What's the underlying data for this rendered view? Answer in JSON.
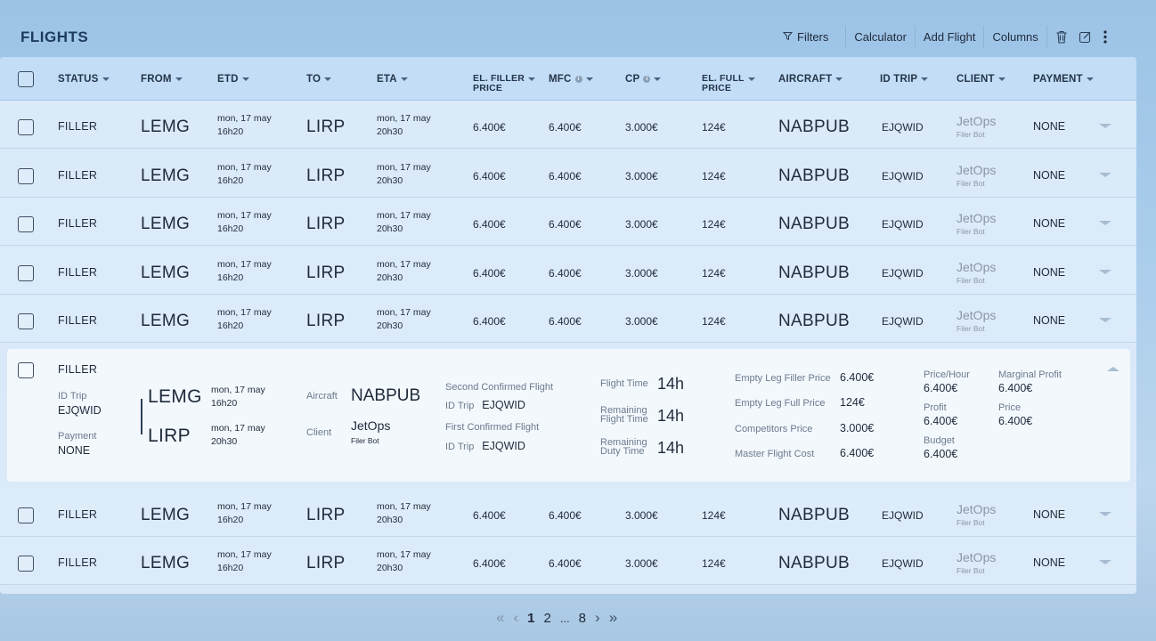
{
  "title": "FLIGHTS",
  "toolbar": {
    "filters": "Filters",
    "calculator": "Calculator",
    "add_flight": "Add Flight",
    "columns": "Columns",
    "icons": [
      "filter-icon",
      "trash-icon",
      "edit-icon",
      "more-icon"
    ]
  },
  "columns": [
    "STATUS",
    "FROM",
    "ETD",
    "TO",
    "ETA",
    "EL. FILLER PRICE",
    "MFC",
    "CP",
    "EL. FULL PRICE",
    "AIRCRAFT",
    "ID TRIP",
    "CLIENT",
    "PAYMENT"
  ],
  "column_lines": {
    "el_filler_1": "EL. FILLER",
    "el_filler_2": "PRICE",
    "el_full_1": "EL. FULL",
    "el_full_2": "PRICE"
  },
  "rows": [
    {
      "status": "FILLER",
      "from": "LEMG",
      "etd_day": "mon, 17 may",
      "etd_time": "16h20",
      "to": "LIRP",
      "eta_day": "mon, 17 may",
      "eta_time": "20h30",
      "el_filler_price": "6.400€",
      "mfc": "6.400€",
      "cp": "3.000€",
      "el_full_price": "124€",
      "aircraft": "NABPUB",
      "id_trip": "EJQWID",
      "client": "JetOps",
      "client_sub": "Filer Bot",
      "payment": "NONE"
    },
    {
      "status": "FILLER",
      "from": "LEMG",
      "etd_day": "mon, 17 may",
      "etd_time": "16h20",
      "to": "LIRP",
      "eta_day": "mon, 17 may",
      "eta_time": "20h30",
      "el_filler_price": "6.400€",
      "mfc": "6.400€",
      "cp": "3.000€",
      "el_full_price": "124€",
      "aircraft": "NABPUB",
      "id_trip": "EJQWID",
      "client": "JetOps",
      "client_sub": "Filer Bot",
      "payment": "NONE"
    },
    {
      "status": "FILLER",
      "from": "LEMG",
      "etd_day": "mon, 17 may",
      "etd_time": "16h20",
      "to": "LIRP",
      "eta_day": "mon, 17 may",
      "eta_time": "20h30",
      "el_filler_price": "6.400€",
      "mfc": "6.400€",
      "cp": "3.000€",
      "el_full_price": "124€",
      "aircraft": "NABPUB",
      "id_trip": "EJQWID",
      "client": "JetOps",
      "client_sub": "Filer Bot",
      "payment": "NONE"
    },
    {
      "status": "FILLER",
      "from": "LEMG",
      "etd_day": "mon, 17 may",
      "etd_time": "16h20",
      "to": "LIRP",
      "eta_day": "mon, 17 may",
      "eta_time": "20h30",
      "el_filler_price": "6.400€",
      "mfc": "6.400€",
      "cp": "3.000€",
      "el_full_price": "124€",
      "aircraft": "NABPUB",
      "id_trip": "EJQWID",
      "client": "JetOps",
      "client_sub": "Filer Bot",
      "payment": "NONE"
    },
    {
      "status": "FILLER",
      "from": "LEMG",
      "etd_day": "mon, 17 may",
      "etd_time": "16h20",
      "to": "LIRP",
      "eta_day": "mon, 17 may",
      "eta_time": "20h30",
      "el_filler_price": "6.400€",
      "mfc": "6.400€",
      "cp": "3.000€",
      "el_full_price": "124€",
      "aircraft": "NABPUB",
      "id_trip": "EJQWID",
      "client": "JetOps",
      "client_sub": "Filer Bot",
      "payment": "NONE"
    },
    {
      "status": "FILLER",
      "from": "LEMG",
      "etd_day": "mon, 17 may",
      "etd_time": "16h20",
      "to": "LIRP",
      "eta_day": "mon, 17 may",
      "eta_time": "20h30",
      "el_filler_price": "6.400€",
      "mfc": "6.400€",
      "cp": "3.000€",
      "el_full_price": "124€",
      "aircraft": "NABPUB",
      "id_trip": "EJQWID",
      "client": "JetOps",
      "client_sub": "Filer Bot",
      "payment": "NONE"
    },
    {
      "status": "FILLER",
      "from": "LEMG",
      "etd_day": "mon, 17 may",
      "etd_time": "16h20",
      "to": "LIRP",
      "eta_day": "mon, 17 may",
      "eta_time": "20h30",
      "el_filler_price": "6.400€",
      "mfc": "6.400€",
      "cp": "3.000€",
      "el_full_price": "124€",
      "aircraft": "NABPUB",
      "id_trip": "EJQWID",
      "client": "JetOps",
      "client_sub": "Filer Bot",
      "payment": "NONE"
    }
  ],
  "expanded": {
    "status": "FILLER",
    "id_trip_label": "ID Trip",
    "id_trip": "EJQWID",
    "payment_label": "Payment",
    "payment": "NONE",
    "from": "LEMG",
    "etd_day": "mon, 17 may",
    "etd_time": "16h20",
    "to": "LIRP",
    "eta_day": "mon, 17 may",
    "eta_time": "20h30",
    "aircraft_label": "Aircraft",
    "aircraft": "NABPUB",
    "client_label": "Client",
    "client": "JetOps",
    "client_sub": "Filer Bot",
    "second_confirmed": "Second Confirmed Flight",
    "second_id_label": "ID Trip",
    "second_id": "EJQWID",
    "first_confirmed": "First Confirmed Flight",
    "first_id_label": "ID Trip",
    "first_id": "EJQWID",
    "flight_time_label": "Flight Time",
    "flight_time": "14h",
    "rem_flight_1": "Remaining",
    "rem_flight_2": "Flight Time",
    "rem_flight_time": "14h",
    "rem_duty_1": "Remaining",
    "rem_duty_2": "Duty Time",
    "rem_duty_time": "14h",
    "el_filler_label": "Empty Leg Filler Price",
    "el_filler": "6.400€",
    "el_full_label": "Empty Leg Full Price",
    "el_full": "124€",
    "competitors_label": "Competitors Price",
    "competitors": "3.000€",
    "master_label": "Master Flight Cost",
    "master": "6.400€",
    "price_hour_label": "Price/Hour",
    "price_hour": "6.400€",
    "profit_label": "Profit",
    "profit": "6.400€",
    "budget_label": "Budget",
    "budget": "6.400€",
    "marginal_label": "Marginal Profit",
    "marginal": "6.400€",
    "price_label": "Price",
    "price": "6.400€"
  },
  "pagination": {
    "first": "«",
    "prev": "‹",
    "pages": [
      "1",
      "2",
      "...",
      "8"
    ],
    "next": "›",
    "last": "»",
    "current": "1"
  }
}
